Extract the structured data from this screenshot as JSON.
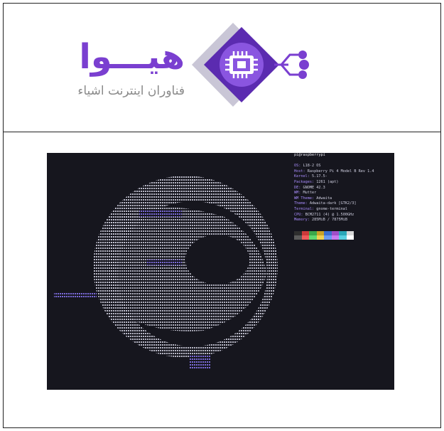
{
  "logo": {
    "title": "هیـــوا",
    "subtitle": "فناوران اینترنت اشیاء",
    "colors": {
      "purple": "#7a3fd0",
      "dark_purple": "#5b2bb0",
      "grey": "#8a8a8a"
    }
  },
  "terminal": {
    "host_line": "pi@raspberrypi",
    "info": [
      {
        "key": "OS:",
        "value": "L18-2 OS"
      },
      {
        "key": "Host:",
        "value": "Raspberry Pi 4 Model B Rev 1.4"
      },
      {
        "key": "Kernel:",
        "value": "5.17.5-"
      },
      {
        "key": "Packages:",
        "value": "1261 (apt)"
      },
      {
        "key": "DE:",
        "value": "GNOME 42.3"
      },
      {
        "key": "WM:",
        "value": "Mutter"
      },
      {
        "key": "WM Theme:",
        "value": "Adwaita"
      },
      {
        "key": "Theme:",
        "value": "Adwaita-dark [GTK2/3]"
      },
      {
        "key": "Terminal:",
        "value": "gnome-terminal"
      },
      {
        "key": "CPU:",
        "value": "BCM2711 (4) @ 1.500GHz"
      },
      {
        "key": "Memory:",
        "value": "285MiB / 7875MiB"
      }
    ],
    "palette_top": [
      "#2e2e2e",
      "#cc3a3a",
      "#3aa84a",
      "#c9a227",
      "#3a6fd0",
      "#a04ec9",
      "#2aa8b8",
      "#d8d8d8"
    ],
    "palette_bottom": [
      "#5a5a5a",
      "#ef5a5a",
      "#5fd86f",
      "#f0d050",
      "#6a9af0",
      "#c87af0",
      "#5ad0e0",
      "#ffffff"
    ],
    "colors": {
      "background": "#16161e",
      "text": "#cfcfe0",
      "accent": "#a78bfa"
    }
  }
}
